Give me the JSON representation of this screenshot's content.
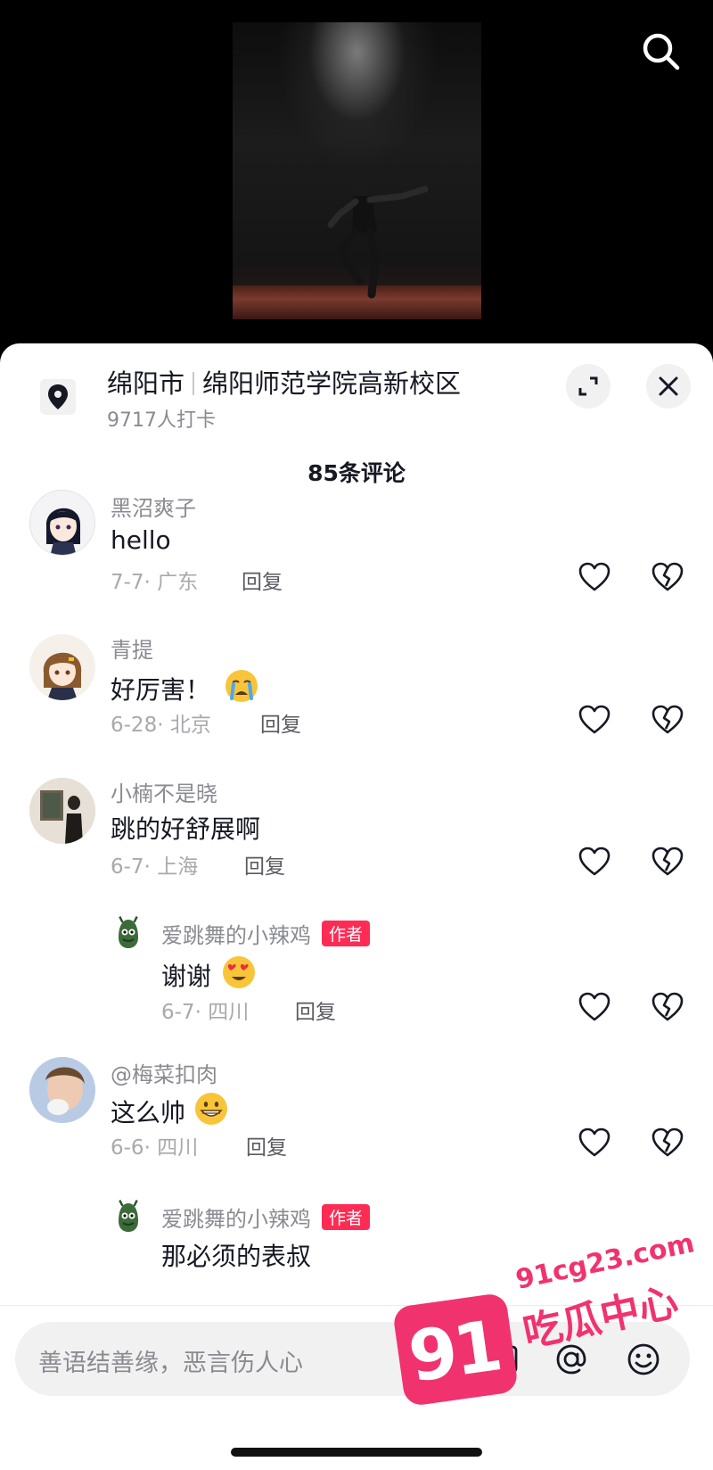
{
  "location": {
    "city": "绵阳市",
    "place": "绵阳师范学院高新校区",
    "checkins": "9717人打卡"
  },
  "comment_count": "85条评论",
  "comments": [
    {
      "user": "黑沼爽子",
      "text": "hello",
      "date_region": "7-7· 广东",
      "reply": "回复"
    },
    {
      "user": "青提",
      "text": "好厉害！",
      "date_region": "6-28· 北京",
      "reply": "回复",
      "emoji": "crying-face"
    },
    {
      "user": "小楠不是晓",
      "text": "跳的好舒展啊",
      "date_region": "6-7· 上海",
      "reply": "回复"
    },
    {
      "user": "爱跳舞的小辣鸡",
      "badge": "作者",
      "text": "谢谢",
      "date_region": "6-7· 四川",
      "reply": "回复",
      "emoji": "heart-eyes-face"
    },
    {
      "user": "@梅菜扣肉",
      "text": "这么帅",
      "date_region": "6-6· 四川",
      "reply": "回复",
      "emoji": "grinning-face"
    },
    {
      "user": "爱跳舞的小辣鸡",
      "badge": "作者",
      "text": "那必须的表叔"
    }
  ],
  "input": {
    "placeholder": "善语结善缘，恶言伤人心"
  },
  "watermark": {
    "number": "91",
    "site": "91cg23.com",
    "brand": "吃瓜中心"
  },
  "colors": {
    "accent": "#fe2c55",
    "watermark": "#f0336f",
    "sheet_bg": "#ffffff",
    "input_bg": "#f1f1f2"
  }
}
